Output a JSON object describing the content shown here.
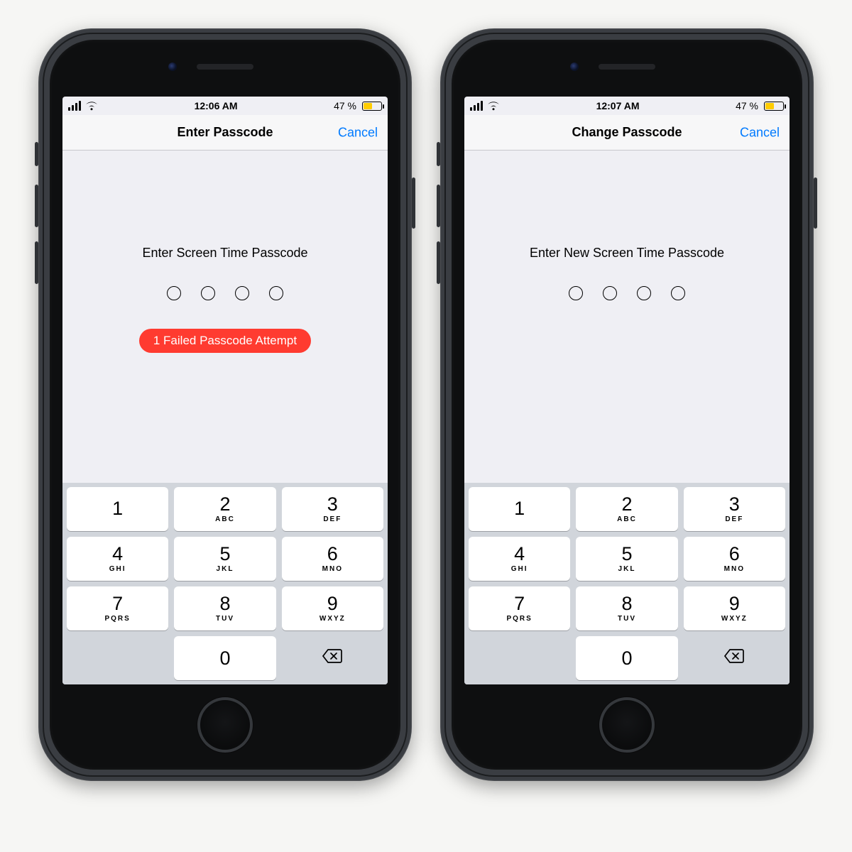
{
  "screens": [
    {
      "status": {
        "time": "12:06 AM",
        "battery_text": "47 %"
      },
      "nav": {
        "title": "Enter Passcode",
        "cancel": "Cancel"
      },
      "prompt": "Enter Screen Time Passcode",
      "fail": "1 Failed Passcode Attempt",
      "show_fail": true
    },
    {
      "status": {
        "time": "12:07 AM",
        "battery_text": "47 %"
      },
      "nav": {
        "title": "Change Passcode",
        "cancel": "Cancel"
      },
      "prompt": "Enter New Screen Time Passcode",
      "fail": "",
      "show_fail": false
    }
  ],
  "keypad": [
    {
      "num": "1",
      "sub": ""
    },
    {
      "num": "2",
      "sub": "ABC"
    },
    {
      "num": "3",
      "sub": "DEF"
    },
    {
      "num": "4",
      "sub": "GHI"
    },
    {
      "num": "5",
      "sub": "JKL"
    },
    {
      "num": "6",
      "sub": "MNO"
    },
    {
      "num": "7",
      "sub": "PQRS"
    },
    {
      "num": "8",
      "sub": "TUV"
    },
    {
      "num": "9",
      "sub": "WXYZ"
    },
    {
      "num": "0",
      "sub": ""
    }
  ]
}
